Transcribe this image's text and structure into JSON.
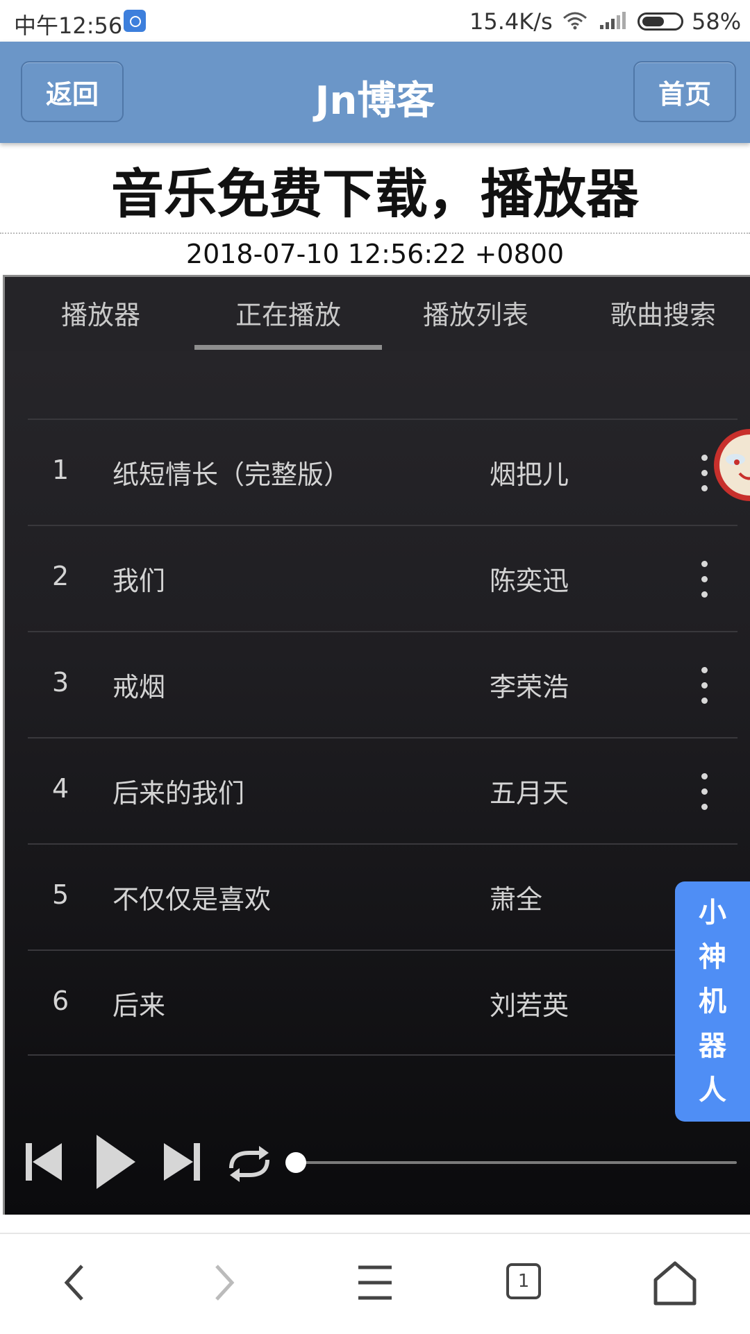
{
  "status_bar": {
    "time": "中午12:56",
    "net_speed": "15.4K/s",
    "battery_percent": "58%",
    "battery_level": 0.58
  },
  "header": {
    "back_label": "返回",
    "title": "Jn博客",
    "home_label": "首页"
  },
  "article": {
    "title": "音乐免费下载，播放器",
    "date": "2018-07-10 12:56:22 +0800"
  },
  "player": {
    "tabs": [
      "播放器",
      "正在播放",
      "播放列表",
      "歌曲搜索"
    ],
    "active_tab": 1,
    "songs": [
      {
        "num": "1",
        "title": "纸短情长（完整版）",
        "artist": "烟把儿"
      },
      {
        "num": "2",
        "title": "我们",
        "artist": "陈奕迅"
      },
      {
        "num": "3",
        "title": "戒烟",
        "artist": "李荣浩"
      },
      {
        "num": "4",
        "title": "后来的我们",
        "artist": "五月天"
      },
      {
        "num": "5",
        "title": "不仅仅是喜欢",
        "artist": "萧全"
      },
      {
        "num": "6",
        "title": "后来",
        "artist": "刘若英"
      }
    ],
    "progress": 0
  },
  "assistant": {
    "label": "小神机器人"
  },
  "bottom_nav": {
    "tab_count": "1"
  },
  "colors": {
    "header_bg": "#6b96c8",
    "assistant_bg": "#4f8ef5",
    "player_bg": "#1f1e22"
  }
}
